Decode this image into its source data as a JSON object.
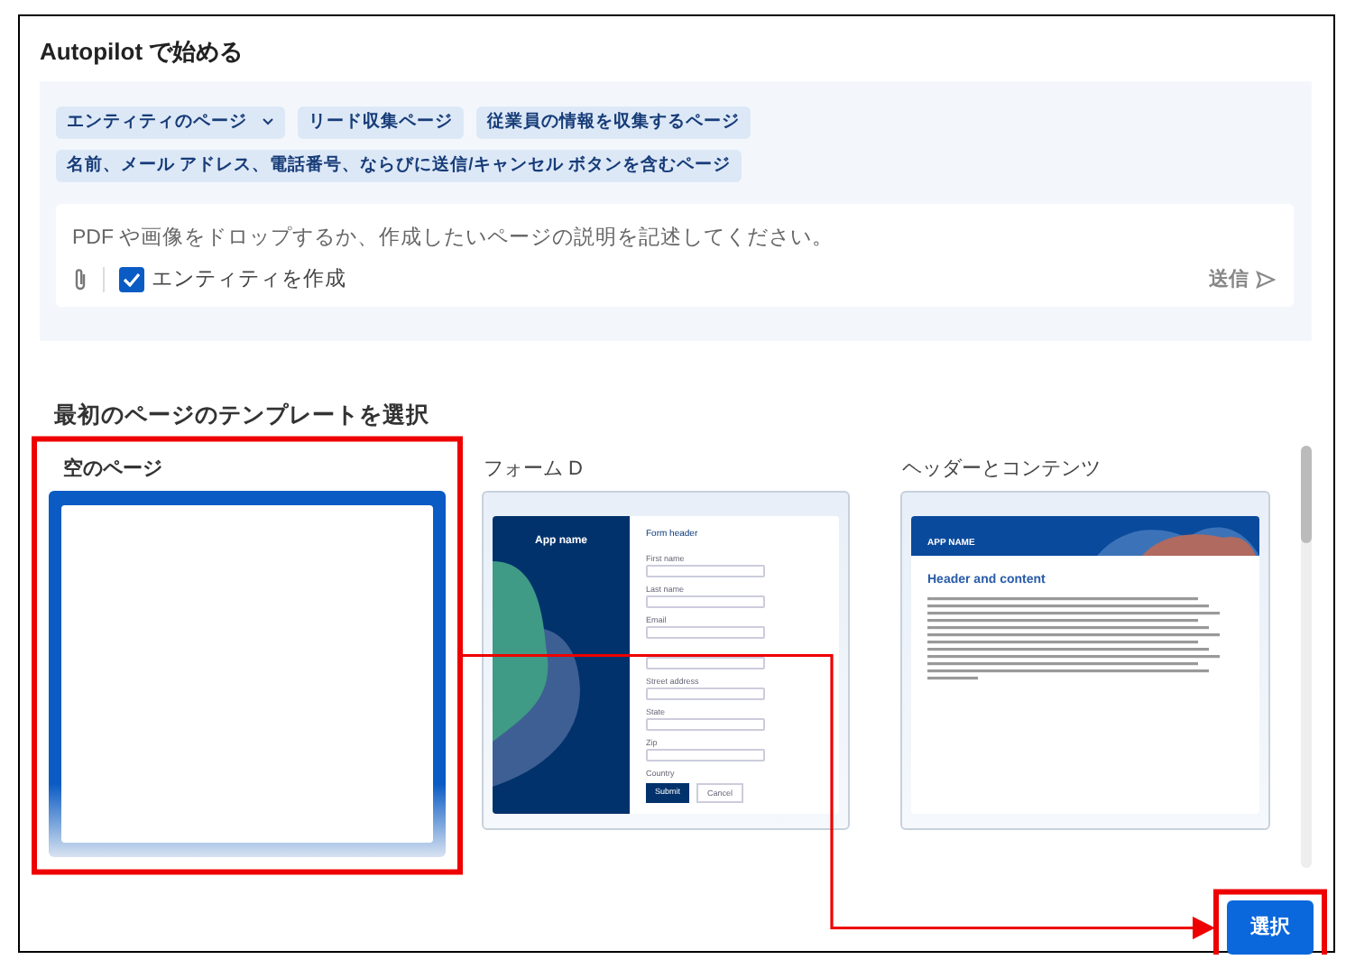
{
  "title": "Autopilot で始める",
  "suggestions": [
    {
      "label": "エンティティのページ",
      "kind": "menu"
    },
    {
      "label": "リード収集ページ",
      "kind": "chip"
    },
    {
      "label": "従業員の情報を収集するページ",
      "kind": "chip"
    },
    {
      "label": "名前、メール アドレス、電話番号、ならびに送信/キャンセル ボタンを含むページ",
      "kind": "chip"
    }
  ],
  "prompt": {
    "placeholder": "PDF や画像をドロップするか、作成したいページの説明を記述してください。",
    "create_entity": {
      "label": "エンティティを作成",
      "checked": true
    },
    "send_label": "送信"
  },
  "templates_heading": "最初のページのテンプレートを選択",
  "templates": [
    {
      "name": "空のページ",
      "kind": "blank",
      "selected": true
    },
    {
      "name": "フォーム D",
      "kind": "form",
      "selected": false,
      "preview": {
        "app_name": "App name",
        "form_header": "Form header",
        "fields": [
          {
            "label": "First name",
            "kind": "text"
          },
          {
            "label": "Last name",
            "kind": "text"
          },
          {
            "label": "Email",
            "kind": "text"
          },
          {
            "kind": "text"
          },
          {
            "label": "Street address",
            "kind": "text"
          },
          {
            "label": "State",
            "kind": "select"
          },
          {
            "label": "Zip",
            "kind": "text"
          },
          {
            "label": "Country",
            "kind": "none"
          }
        ],
        "submit": "Submit",
        "cancel": "Cancel"
      }
    },
    {
      "name": "ヘッダーとコンテンツ",
      "kind": "header_content",
      "selected": false,
      "preview": {
        "app_name": "APP NAME",
        "heading": "Header and content"
      }
    }
  ],
  "select_button": "選択"
}
